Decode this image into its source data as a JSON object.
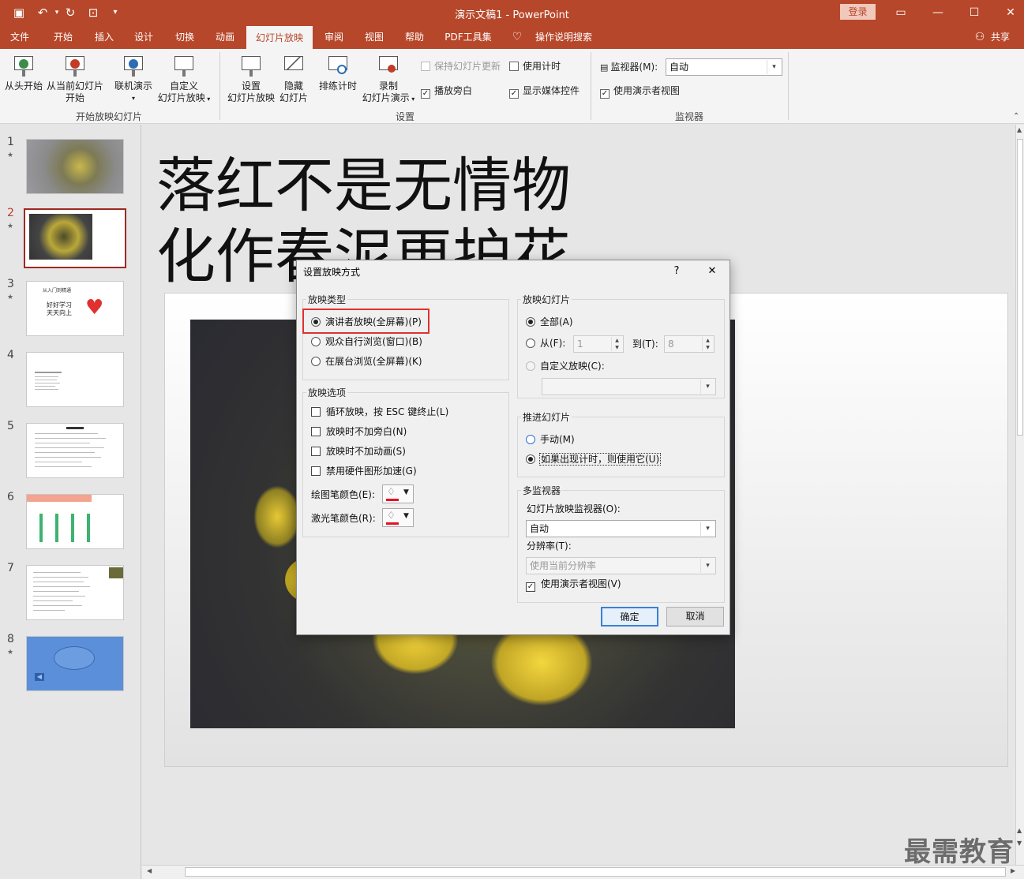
{
  "app": {
    "doc_title": "演示文稿1  -  PowerPoint",
    "login_label": "登录",
    "share_label": "共享"
  },
  "tabs": [
    {
      "label": "文件"
    },
    {
      "label": "开始"
    },
    {
      "label": "插入"
    },
    {
      "label": "设计"
    },
    {
      "label": "切换"
    },
    {
      "label": "动画"
    },
    {
      "label": "幻灯片放映"
    },
    {
      "label": "审阅"
    },
    {
      "label": "视图"
    },
    {
      "label": "帮助"
    },
    {
      "label": "PDF工具集"
    },
    {
      "label": "操作说明搜索"
    }
  ],
  "ribbon": {
    "from_start": "从头开始",
    "from_current_1": "从当前幻灯片",
    "from_current_2": "开始",
    "online_present": "联机演示",
    "custom_show_1": "自定义",
    "custom_show_2": "幻灯片放映",
    "group_start": "开始放映幻灯片",
    "setup_1": "设置",
    "setup_2": "幻灯片放映",
    "hide_1": "隐藏",
    "hide_2": "幻灯片",
    "rehearse": "排练计时",
    "record_1": "录制",
    "record_2": "幻灯片演示",
    "keep_updated": "保持幻灯片更新",
    "use_timings": "使用计时",
    "play_narration": "播放旁白",
    "show_media": "显示媒体控件",
    "group_setup": "设置",
    "monitor_label": "监视器(M):",
    "monitor_value": "自动",
    "presenter_view": "使用演示者视图",
    "group_monitor": "监视器"
  },
  "thumbnails": [
    {
      "num": "1",
      "star": "★"
    },
    {
      "num": "2",
      "star": "★"
    },
    {
      "num": "3",
      "star": "★",
      "line1": "从入门到精通",
      "line2": "好好学习",
      "line3": "天天向上"
    },
    {
      "num": "4",
      "star": ""
    },
    {
      "num": "5",
      "star": ""
    },
    {
      "num": "6",
      "star": ""
    },
    {
      "num": "7",
      "star": ""
    },
    {
      "num": "8",
      "star": "★"
    }
  ],
  "slide": {
    "title": "落红不是无情物\n化作春泥更护花"
  },
  "dialog": {
    "title": "设置放映方式",
    "help": "?",
    "close": "✕",
    "show_type": {
      "legend": "放映类型",
      "presenter": "演讲者放映(全屏幕)(P)",
      "individual": "观众自行浏览(窗口)(B)",
      "kiosk": "在展台浏览(全屏幕)(K)"
    },
    "show_options": {
      "legend": "放映选项",
      "loop": "循环放映，按 ESC 键终止(L)",
      "no_narration": "放映时不加旁白(N)",
      "no_animation": "放映时不加动画(S)",
      "no_hw_accel": "禁用硬件图形加速(G)",
      "pen_color": "绘图笔颜色(E):",
      "laser_color": "激光笔颜色(R):",
      "pen_hex": "#e81123",
      "laser_hex": "#e81123"
    },
    "show_slides": {
      "legend": "放映幻灯片",
      "all": "全部(A)",
      "from": "从(F):",
      "from_value": "1",
      "to": "到(T):",
      "to_value": "8",
      "custom": "自定义放映(C):"
    },
    "advance": {
      "legend": "推进幻灯片",
      "manual": "手动(M)",
      "timings": "如果出现计时，则使用它(U)"
    },
    "multi": {
      "legend": "多监视器",
      "monitor_label": "幻灯片放映监视器(O):",
      "monitor_value": "自动",
      "resolution_label": "分辨率(T):",
      "resolution_value": "使用当前分辨率",
      "presenter_view": "使用演示者视图(V)"
    },
    "ok": "确定",
    "cancel": "取消"
  },
  "watermark": "最需教育"
}
